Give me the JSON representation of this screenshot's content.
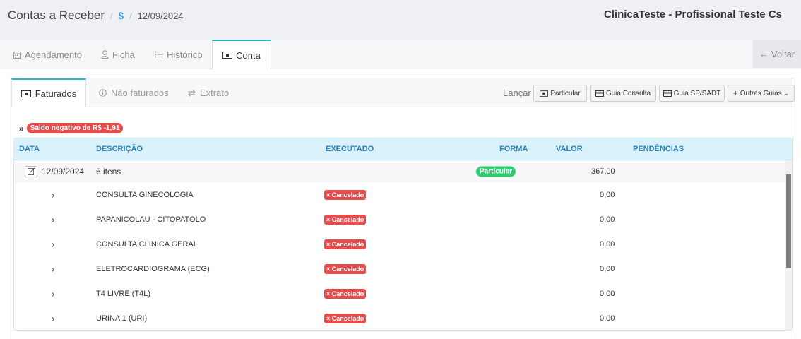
{
  "header": {
    "title": "Contas a Receber",
    "crumb_separator": "/",
    "crumb_icon": "$",
    "date": "12/09/2024",
    "clinic": "ClinicaTeste - Profissional Teste Cs"
  },
  "tabs": [
    {
      "label": "Agendamento",
      "icon": "calendar-icon"
    },
    {
      "label": "Ficha",
      "icon": "user-icon"
    },
    {
      "label": "Histórico",
      "icon": "list-icon"
    },
    {
      "label": "Conta",
      "icon": "money-icon",
      "active": true
    }
  ],
  "back_label": "Voltar",
  "subtabs": [
    {
      "label": "Faturados",
      "active": true
    },
    {
      "label": "Não faturados"
    },
    {
      "label": "Extrato"
    }
  ],
  "lancar": {
    "label": "Lançar",
    "buttons": [
      "Particular",
      "Guia Consulta",
      "Guia SP/SADT",
      "Outras Guias"
    ]
  },
  "saldo": {
    "prefix": "»",
    "text": "Saldo negativo de R$ -1,91"
  },
  "table": {
    "headers": {
      "data": "DATA",
      "descricao": "DESCRIÇÃO",
      "executado": "EXECUTADO",
      "forma": "FORMA",
      "valor": "VALOR",
      "pendencias": "PENDÊNCIAS"
    },
    "main_row": {
      "date": "12/09/2024",
      "descricao": "6 itens",
      "forma": "Particular",
      "valor": "367,00"
    },
    "items": [
      {
        "expand": "›",
        "descricao": "CONSULTA GINECOLOGIA",
        "status": "× Cancelado",
        "valor": "0,00"
      },
      {
        "expand": "›",
        "descricao": "PAPANICOLAU - CITOPATOLO",
        "status": "× Cancelado",
        "valor": "0,00"
      },
      {
        "expand": "›",
        "descricao": "CONSULTA CLINICA GERAL",
        "status": "× Cancelado",
        "valor": "0,00"
      },
      {
        "expand": "›",
        "descricao": "ELETROCARDIOGRAMA (ECG)",
        "status": "× Cancelado",
        "valor": "0,00"
      },
      {
        "expand": "›",
        "descricao": "T4 LIVRE (T4L)",
        "status": "× Cancelado",
        "valor": "0,00"
      },
      {
        "expand": "›",
        "descricao": "URINA 1 (URI)",
        "status": "× Cancelado",
        "valor": "0,00"
      }
    ]
  },
  "colors": {
    "accent": "#26b4c8",
    "header_blue": "#2980b9",
    "danger": "#e74c4c",
    "success": "#2ecc71"
  }
}
